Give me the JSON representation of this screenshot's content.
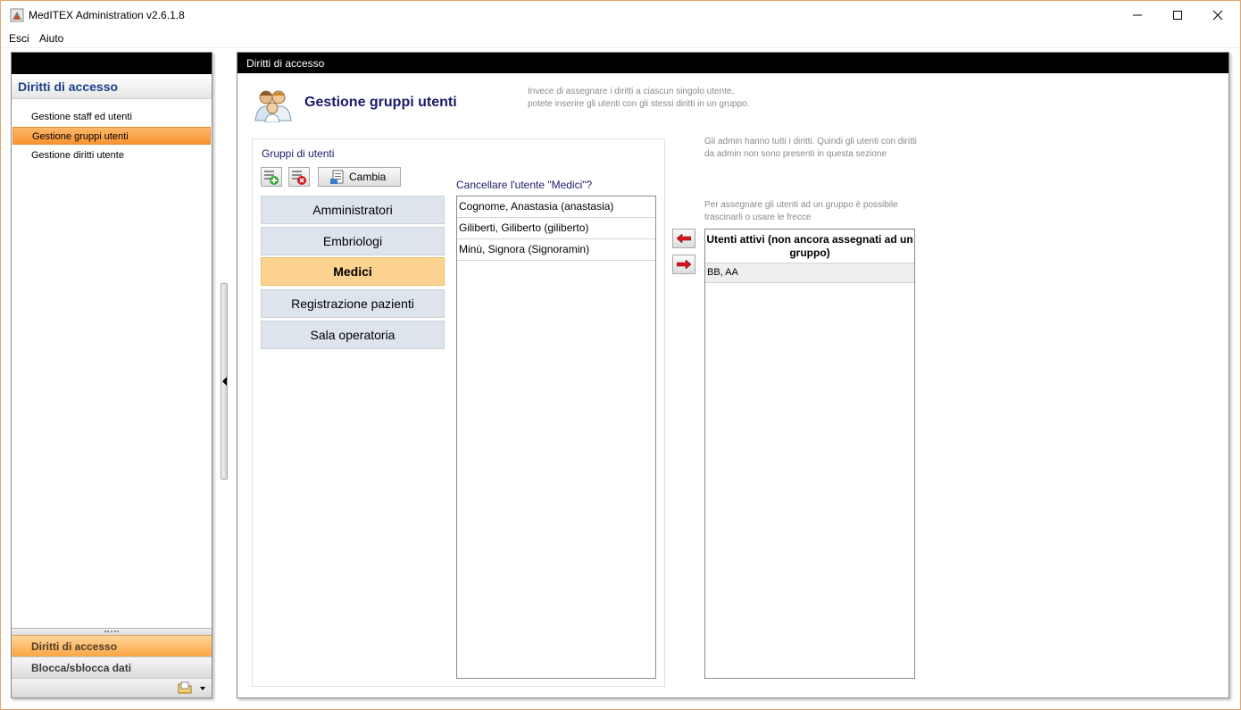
{
  "window": {
    "title": "MedITEX Administration v2.6.1.8"
  },
  "menu": {
    "items": [
      "Esci",
      "Aiuto"
    ]
  },
  "left_panel": {
    "header": "Diritti di accesso",
    "nav_items": [
      "Gestione staff ed utenti",
      "Gestione gruppi utenti",
      "Gestione diritti utente"
    ],
    "active_nav": "Gestione gruppi utenti",
    "bottom_buttons": [
      "Diritti di accesso",
      "Blocca/sblocca dati"
    ]
  },
  "main": {
    "section_title": "Diritti di accesso",
    "page_title": "Gestione gruppi utenti",
    "page_desc_1": "Invece di assegnare i diritti a ciascun singolo utente,",
    "page_desc_2": "potete inserire gli utenti con gli stessi diritti in un gruppo.",
    "groups_label": "Gruppi di utenti",
    "cambia_label": "Cambia",
    "groups": [
      "Amministratori",
      "Embriologi",
      "Medici",
      "Registrazione pazienti",
      "Sala operatoria"
    ],
    "active_group": "Medici",
    "cancel_prompt": "Cancellare l'utente \"Medici\"?",
    "group_users": [
      "Cognome, Anastasia  (anastasia)",
      "Giliberti, Giliberto  (giliberto)",
      "Minù, Signora  (Signoramin)"
    ],
    "admin_note": "Gli admin hanno tutti i diritti. Quindi gli utenti con diritti da admin non sono presenti in questa sezione",
    "assign_note": "Per assegnare gli utenti ad un gruppo è possibile trascinarli o usare le frecce",
    "active_users_header": "Utenti attivi (non ancora assegnati ad un gruppo)",
    "active_users": [
      "BB, AA"
    ]
  },
  "colors": {
    "accent_orange": "#f99432",
    "title_blue": "#1b1b6b",
    "header_blue": "#1e3f8c",
    "arrow_red": "#d9161b"
  }
}
